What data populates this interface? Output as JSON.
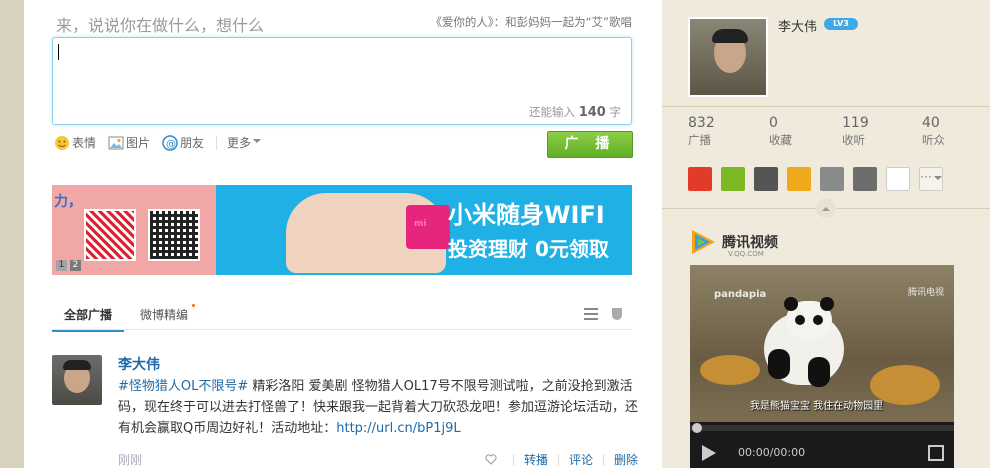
{
  "composer": {
    "prompt": "来，说说你在做什么，想什么",
    "promo_text": "《爱你的人》：和彭妈妈一起为“艾”歌唱",
    "counter_prefix": "还能输入",
    "counter_value": "140",
    "counter_suffix": "字",
    "tools": {
      "emoji": "表情",
      "image": "图片",
      "friend": "朋友",
      "more": "更多"
    },
    "submit_label": "广 播"
  },
  "banner": {
    "slogan": "力，",
    "title": "小米随身WIFI",
    "subtitle": "投资理财 0元领取",
    "dongle_text": "mi",
    "pages": [
      "1",
      "2"
    ]
  },
  "tabs": {
    "all": "全部广播",
    "featured": "微博精编"
  },
  "feed": {
    "author": "李大伟",
    "hashtag": "#怪物猎人OL不限号#",
    "text": " 精彩洛阳 爱美剧 怪物猎人OL17号不限号测试啦，之前没抢到激活码，现在终于可以进去打怪兽了！快来跟我一起背着大刀砍恐龙吧！参加逗游论坛活动，还有机会赢取Q币周边好礼！活动地址：",
    "link": "http://url.cn/bP1j9L",
    "time": "刚刚",
    "actions": {
      "retweet": "转播",
      "comment": "评论",
      "delete": "删除"
    }
  },
  "profile": {
    "name": "李大伟",
    "level": "LV3",
    "stats": [
      {
        "num": "832",
        "label": "广播"
      },
      {
        "num": "0",
        "label": "收藏"
      },
      {
        "num": "119",
        "label": "收听"
      },
      {
        "num": "40",
        "label": "听众"
      }
    ],
    "apps": [
      {
        "icon": "star-app-icon",
        "color": "#e23b2a"
      },
      {
        "icon": "music-app-icon",
        "color": "#7cb823"
      },
      {
        "icon": "search-app-icon",
        "color": "#555555"
      },
      {
        "icon": "qq-app-icon",
        "color": "#f0a81d"
      },
      {
        "icon": "chat-app-icon",
        "color": "#8a8a8a"
      },
      {
        "icon": "note-app-icon",
        "color": "#6d6d6d"
      },
      {
        "icon": "blank-app-icon",
        "color": "#ffffff"
      }
    ],
    "more_apps": "···"
  },
  "video": {
    "brand": "腾讯视频",
    "brand_sub": "V.QQ.COM",
    "watermark_left": "pandapia",
    "watermark_right": "腾讯电视",
    "subtitle": "我是熊猫宝宝 我住在动物园里",
    "time": "00:00/00:00",
    "progress": 0
  }
}
